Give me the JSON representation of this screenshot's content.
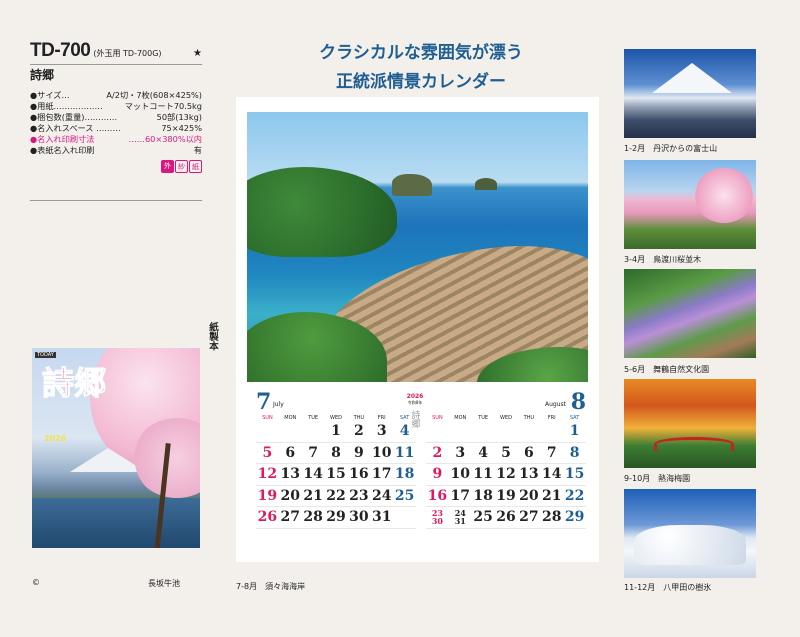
{
  "product": {
    "code": "TD-700",
    "sub_code": "(外玉用 TD-700G)",
    "star": "★",
    "name": "詩郷",
    "specs": [
      {
        "label": "●サイズ…",
        "value": "A/2切・7枚(608×425%)"
      },
      {
        "label": "●用紙………………",
        "value": "マットコート70.5kg"
      },
      {
        "label": "●梱包数(重量)…………",
        "value": "50部(13kg)"
      },
      {
        "label": "●名入れスペース ………",
        "value": "75×425%"
      },
      {
        "label": "●名入れ印刷寸法",
        "value": "……60×380%以内"
      },
      {
        "label": "●表紙名入れ印刷",
        "value": "有"
      }
    ],
    "badges": [
      "外",
      "紗",
      "紙"
    ]
  },
  "cover": {
    "brand": "TODAY",
    "title": "詩郷",
    "year": "2026",
    "vertical_label": "紙製本",
    "copyright": "©",
    "caption": "長坂牛池"
  },
  "headline": {
    "line1": "クラシカルな雰囲気が漂う",
    "line2": "正統派情景カレンダー"
  },
  "calendar": {
    "logo_year": "2026",
    "logo_label": "令和8年",
    "logo_vertical": "詩郷",
    "caption": "7-8月　須々海海岸",
    "dows": [
      "SUN",
      "MON",
      "TUE",
      "WED",
      "THU",
      "FRI",
      "SAT"
    ],
    "july": {
      "number": "7",
      "name": "July",
      "weeks": [
        [
          "",
          "",
          "",
          "1",
          "2",
          "3",
          "4"
        ],
        [
          "5",
          "6",
          "7",
          "8",
          "9",
          "10",
          "11"
        ],
        [
          "12",
          "13",
          "14",
          "15",
          "16",
          "17",
          "18"
        ],
        [
          "19",
          "20",
          "21",
          "22",
          "23",
          "24",
          "25"
        ],
        [
          "26",
          "27",
          "28",
          "29",
          "30",
          "31",
          ""
        ]
      ]
    },
    "august": {
      "number": "8",
      "name": "August",
      "weeks": [
        [
          "",
          "",
          "",
          "",
          "",
          "",
          "1"
        ],
        [
          "2",
          "3",
          "4",
          "5",
          "6",
          "7",
          "8"
        ],
        [
          "9",
          "10",
          "11",
          "12",
          "13",
          "14",
          "15"
        ],
        [
          "16",
          "17",
          "18",
          "19",
          "20",
          "21",
          "22"
        ],
        [
          "23/30",
          "24/31",
          "25",
          "26",
          "27",
          "28",
          "29"
        ]
      ]
    }
  },
  "thumbnails": [
    {
      "caption": "1-2月　丹沢からの富士山"
    },
    {
      "caption": "3-4月　鳥渡川桜並木"
    },
    {
      "caption": "5-6月　舞鶴自然文化園"
    },
    {
      "caption": "9-10月　熱海梅園"
    },
    {
      "caption": "11-12月　八甲田の樹氷"
    }
  ]
}
